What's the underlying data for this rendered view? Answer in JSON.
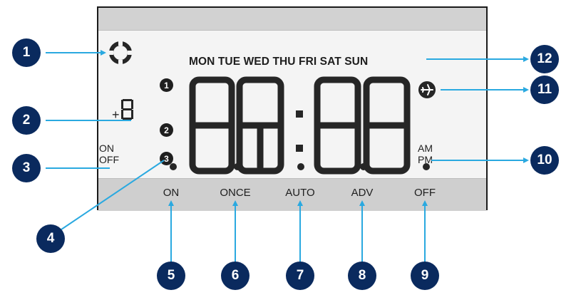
{
  "days_row": "MON TUE WED THU FRI SAT SUN",
  "offset_indicator": "+8",
  "on_label": "ON",
  "off_label": "OFF",
  "am_label": "AM",
  "pm_label": "PM",
  "program_numbers": [
    "1",
    "2",
    "3"
  ],
  "modes": [
    "ON",
    "ONCE",
    "AUTO",
    "ADV",
    "OFF"
  ],
  "callouts": [
    "1",
    "2",
    "3",
    "4",
    "5",
    "6",
    "7",
    "8",
    "9",
    "10",
    "11",
    "12"
  ],
  "colors": {
    "callout": "#0a2a5e",
    "arrow": "#2aa9e0",
    "segment": "#262626",
    "lcd_background": "#f4f4f4",
    "lcd_bar": "#d0d0d0"
  },
  "icons": {
    "status": "ring-icon",
    "holiday": "airplane-icon"
  }
}
